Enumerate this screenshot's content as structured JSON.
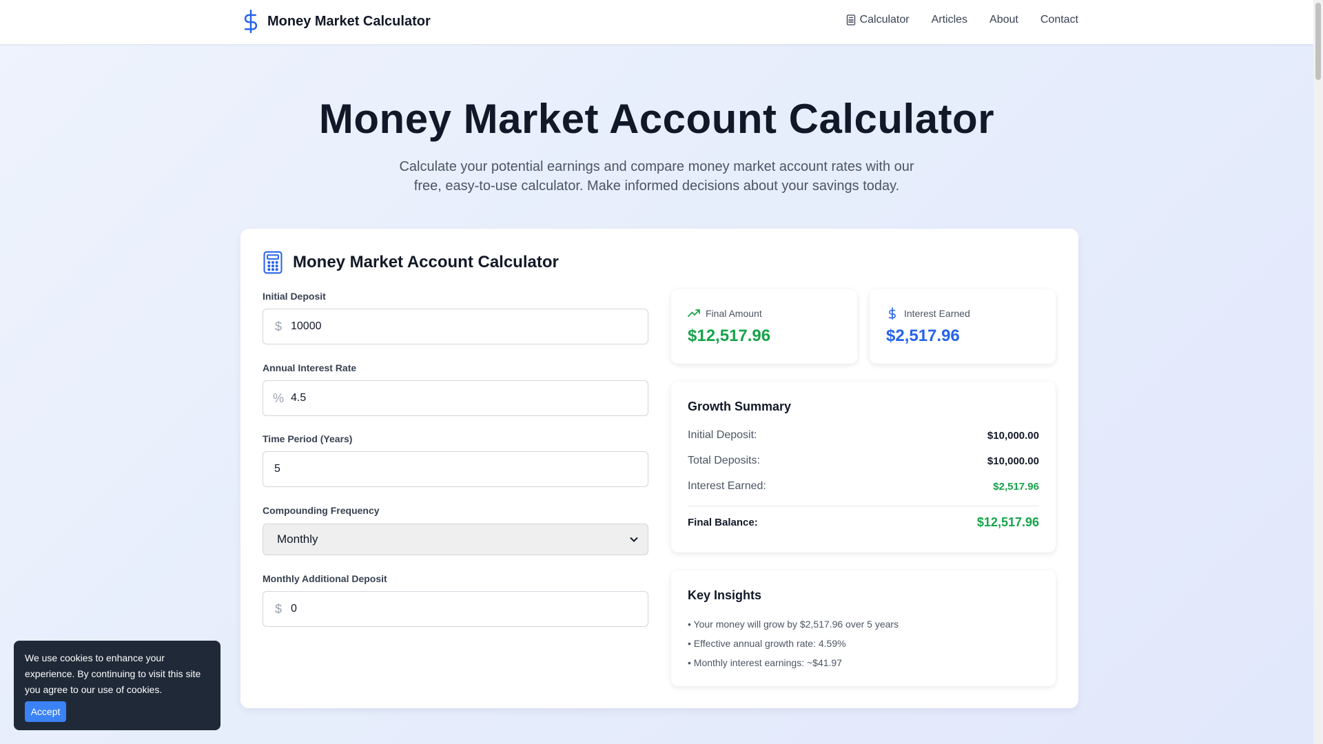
{
  "header": {
    "brand_title": "Money Market Calculator",
    "nav": [
      {
        "label": "Calculator",
        "icon": "calculator-icon"
      },
      {
        "label": "Articles"
      },
      {
        "label": "About"
      },
      {
        "label": "Contact"
      }
    ]
  },
  "hero": {
    "title": "Money Market Account Calculator",
    "subtitle": "Calculate your potential earnings and compare money market account rates with our free, easy-to-use calculator. Make informed decisions about your savings today."
  },
  "calculator": {
    "title": "Money Market Account Calculator",
    "fields": {
      "initial_deposit": {
        "label": "Initial Deposit",
        "prefix": "$",
        "value": "10000"
      },
      "interest_rate": {
        "label": "Annual Interest Rate",
        "prefix": "%",
        "value": "4.5"
      },
      "time_period": {
        "label": "Time Period (Years)",
        "value": "5"
      },
      "compounding": {
        "label": "Compounding Frequency",
        "value": "Monthly"
      },
      "monthly_deposit": {
        "label": "Monthly Additional Deposit",
        "prefix": "$",
        "value": "0"
      }
    }
  },
  "results": {
    "final_amount": {
      "label": "Final Amount",
      "value": "$12,517.96"
    },
    "interest_earned": {
      "label": "Interest Earned",
      "value": "$2,517.96"
    }
  },
  "summary": {
    "title": "Growth Summary",
    "rows": [
      {
        "label": "Initial Deposit:",
        "value": "$10,000.00"
      },
      {
        "label": "Total Deposits:",
        "value": "$10,000.00"
      },
      {
        "label": "Interest Earned:",
        "value": "$2,517.96"
      }
    ],
    "final": {
      "label": "Final Balance:",
      "value": "$12,517.96"
    }
  },
  "insights": {
    "title": "Key Insights",
    "items": [
      "• Your money will grow by $2,517.96 over 5 years",
      "• Effective annual growth rate: 4.59%",
      "• Monthly interest earnings: ~$41.97"
    ]
  },
  "cookie": {
    "text": "We use cookies to enhance your experience. By continuing to visit this site you agree to our use of cookies.",
    "accept": "Accept"
  },
  "colors": {
    "accent": "#2563eb",
    "green": "#16a34a",
    "dark": "#111827"
  }
}
